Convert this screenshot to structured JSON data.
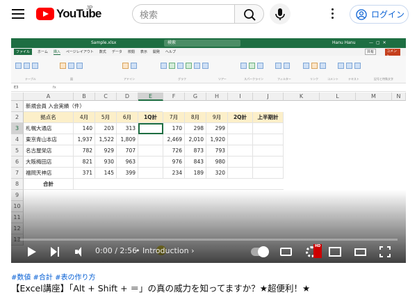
{
  "header": {
    "logo_text": "YouTube",
    "logo_region": "JP",
    "search_placeholder": "検索",
    "login_label": "ログイン",
    "icons": [
      "menu-icon",
      "search-icon",
      "mic-icon",
      "more-icon",
      "account-icon"
    ]
  },
  "excel": {
    "filename": "Sample.xlsx",
    "search_text": "検索",
    "user_name": "Hanu Hanu",
    "ribbon_tabs": [
      "ファイル",
      "ホーム",
      "挿入",
      "ページレイアウト",
      "数式",
      "データ",
      "校閲",
      "表示",
      "開発",
      "ヘルプ"
    ],
    "active_tab": "挿入",
    "share_label": "共有",
    "comment_label": "コメント",
    "ribbon_groups": [
      "テーブル",
      "図",
      "アドイン",
      "グラフ",
      "ツアー",
      "スパークライン",
      "フィルター",
      "リンク",
      "コメント",
      "テキスト",
      "記号と特殊文字"
    ],
    "name_box": "E3",
    "fx_label": "fx",
    "columns": [
      "A",
      "B",
      "C",
      "D",
      "E",
      "F",
      "G",
      "H",
      "I",
      "J",
      "K",
      "L",
      "M",
      "N"
    ],
    "rows": [
      "1",
      "2",
      "3",
      "4",
      "5",
      "6",
      "7",
      "8",
      "9",
      "10",
      "11",
      "12",
      "13"
    ],
    "title_cell": "新規会員 入会実績（件）",
    "table_headers": [
      "拠点名",
      "4月",
      "5月",
      "6月",
      "1Q計",
      "7月",
      "8月",
      "9月",
      "2Q計",
      "上半期計"
    ],
    "table_rows": [
      {
        "name": "札幌大通店",
        "m4": "140",
        "m5": "203",
        "m6": "313",
        "m7": "170",
        "m8": "298",
        "m9": "299"
      },
      {
        "name": "東京青山本店",
        "m4": "1,937",
        "m5": "1,522",
        "m6": "1,809",
        "m7": "2,469",
        "m8": "2,010",
        "m9": "1,920"
      },
      {
        "name": "名古屋栄店",
        "m4": "782",
        "m5": "929",
        "m6": "707",
        "m7": "726",
        "m8": "873",
        "m9": "793"
      },
      {
        "name": "大阪梅田店",
        "m4": "821",
        "m5": "930",
        "m6": "963",
        "m7": "976",
        "m8": "843",
        "m9": "980"
      },
      {
        "name": "福岡天神店",
        "m4": "371",
        "m5": "145",
        "m6": "399",
        "m7": "234",
        "m8": "189",
        "m9": "320"
      }
    ],
    "total_label": "合計"
  },
  "player": {
    "current_time": "0:00",
    "separator": "/",
    "duration": "2:56",
    "chapter": "• Introduction",
    "hd_badge": "HD",
    "autoplay_on": false
  },
  "video": {
    "tags": "#数値 #合計 #表の作り方",
    "title": "【Excel講座】「Alt + Shift + ＝」の真の威力を知ってますか？★超便利！★"
  },
  "colors": {
    "youtube_red": "#ff0000",
    "excel_green": "#1e6e42",
    "header_fill": "#fcefc9",
    "link_blue": "#065fd4"
  }
}
